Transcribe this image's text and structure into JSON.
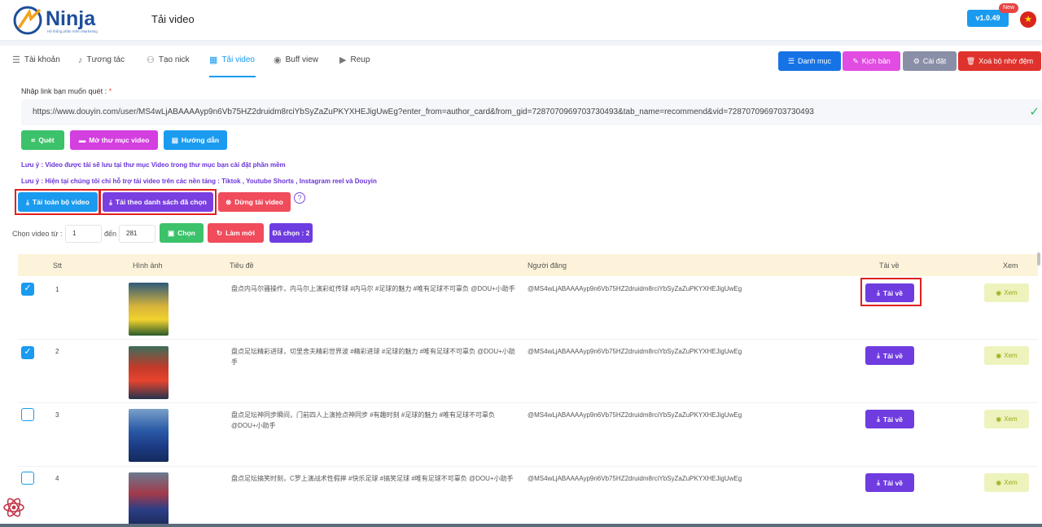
{
  "header": {
    "logo_text": "Ninja",
    "logo_tagline": "Hệ thống phần mềm Marketing",
    "title": "Tải video",
    "version": "v1.0.49",
    "new_badge": "New"
  },
  "tabs": [
    {
      "label": "Tài khoản",
      "icon": "list-icon"
    },
    {
      "label": "Tương tác",
      "icon": "tiktok-icon"
    },
    {
      "label": "Tạo nick",
      "icon": "add-user-icon"
    },
    {
      "label": "Tải video",
      "icon": "film-icon",
      "active": true
    },
    {
      "label": "Buff view",
      "icon": "eye-icon"
    },
    {
      "label": "Reup",
      "icon": "video-icon"
    }
  ],
  "top_actions": {
    "category": "Danh mục",
    "script": "Kịch bản",
    "settings": "Cài đặt",
    "clear_memory": "Xoá bộ nhớ đệm"
  },
  "form": {
    "link_label": "Nhập link bạn muốn quét :",
    "required_mark": "*",
    "url_value": "https://www.douyin.com/user/MS4wLjABAAAAyp9n6Vb75HZ2druidm8rciYbSyZaZuPKYXHEJigUwEg?enter_from=author_card&from_gid=7287070969703730493&tab_name=recommend&vid=7287070969703730493",
    "scan": "Quét",
    "open_folder": "Mở thư mục video",
    "guide": "Hướng dẫn"
  },
  "notes": {
    "note1": "Lưu ý : Video được tải sẽ lưu tại thư mục Video trong thư mục bạn cài đặt phần mềm",
    "note2": "Lưu ý : Hiện tại chúng tôi chỉ hỗ trợ tải video trên các nền tảng : Tiktok , Youtube Shorts , Instagram reel và Douyin"
  },
  "download_actions": {
    "download_all": "Tải toàn bộ video",
    "download_selected": "Tải theo danh sách đã chọn",
    "stop": "Dừng tải video",
    "help": "?"
  },
  "range": {
    "from_label": "Chọn video từ :",
    "from_value": "1",
    "to_label": "đến",
    "to_value": "281",
    "select": "Chọn",
    "refresh": "Làm mới",
    "selected_count": "Đã chọn : 2"
  },
  "table": {
    "headers": {
      "stt": "Stt",
      "image": "Hình ảnh",
      "title": "Tiêu đề",
      "poster": "Người đăng",
      "download": "Tải về",
      "view": "Xem"
    },
    "download_label": "Tải về",
    "view_label": "Xem",
    "rows": [
      {
        "stt": "1",
        "checked": true,
        "title": "盘点内马尔骚操作，内马尔上演彩虹传球 #内马尔 #足球的魅力 #唯有足球不可辜负 @DOU+小助手",
        "poster": "@MS4wLjABAAAAyp9n6Vb75HZ2druidm8rciYbSyZaZuPKYXHEJigUwEg"
      },
      {
        "stt": "2",
        "checked": true,
        "title": "盘点足坛精彩进球，切里舍夫精彩世界波 #精彩进球 #足球的魅力 #唯有足球不可辜负 @DOU+小助手",
        "poster": "@MS4wLjABAAAAyp9n6Vb75HZ2druidm8rciYbSyZaZuPKYXHEJigUwEg"
      },
      {
        "stt": "3",
        "checked": false,
        "title": "盘点足坛神同步瞬间，门前四人上演抢点神同步 #有趣时刻 #足球的魅力 #唯有足球不可辜负 @DOU+小助手",
        "poster": "@MS4wLjABAAAAyp9n6Vb75HZ2druidm8rciYbSyZaZuPKYXHEJigUwEg"
      },
      {
        "stt": "4",
        "checked": false,
        "title": "盘点足坛搞笑时刻，C罗上演战术性假摔 #快乐足球 #搞笑足球 #唯有足球不可辜负 @DOU+小助手",
        "poster": "@MS4wLjABAAAAyp9n6Vb75HZ2druidm8rciYbSyZaZuPKYXHEJigUwEg"
      }
    ]
  },
  "colors": {
    "primary_blue": "#1a9bf0",
    "purple": "#6f3ce0",
    "magenta": "#d43fe0",
    "green": "#3cc26a",
    "red": "#e84545",
    "highlight_frame": "#e02020"
  }
}
